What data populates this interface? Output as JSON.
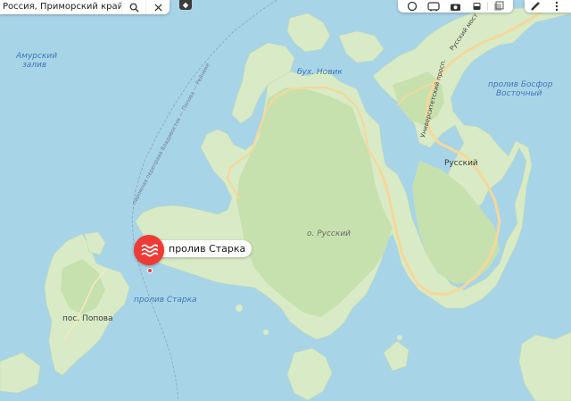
{
  "search": {
    "query": "Россия, Приморский край, пролив Старка",
    "search_icon": "search-icon",
    "clear_icon": "close-icon"
  },
  "toolbar": {
    "icons": [
      "traffic-icon",
      "transit-icon",
      "panorama-camera-icon",
      "bus-icon",
      "layers-icon"
    ]
  },
  "toolbar2": {
    "icons": [
      "ruler-icon",
      "more-icon"
    ]
  },
  "route_button": {
    "icon": "route-icon"
  },
  "marker": {
    "title": "пролив Старка",
    "icon": "water-waves-icon",
    "color": "#ef3b35"
  },
  "labels": {
    "amur_bay_1": "Амурский",
    "amur_bay_2": "залив",
    "novik_bay": "бух. Новик",
    "bosphorus_1": "пролив Босфор",
    "bosphorus_2": "Восточный",
    "russky_village": "Русский",
    "russky_island": "о. Русский",
    "starka_strait": "пролив Старка",
    "popova_village": "пос. Попова",
    "ferry_route": "паромная переправа Владивосток — Попова — Рейнеке",
    "russky_bridge": "Русский мост",
    "university_ave": "Университетский просп."
  },
  "colors": {
    "water": "#a8d4e8",
    "land": "#d8ebc6",
    "forest": "#c6e1ae",
    "road": "#f6d79a",
    "marker": "#ef3b35"
  }
}
